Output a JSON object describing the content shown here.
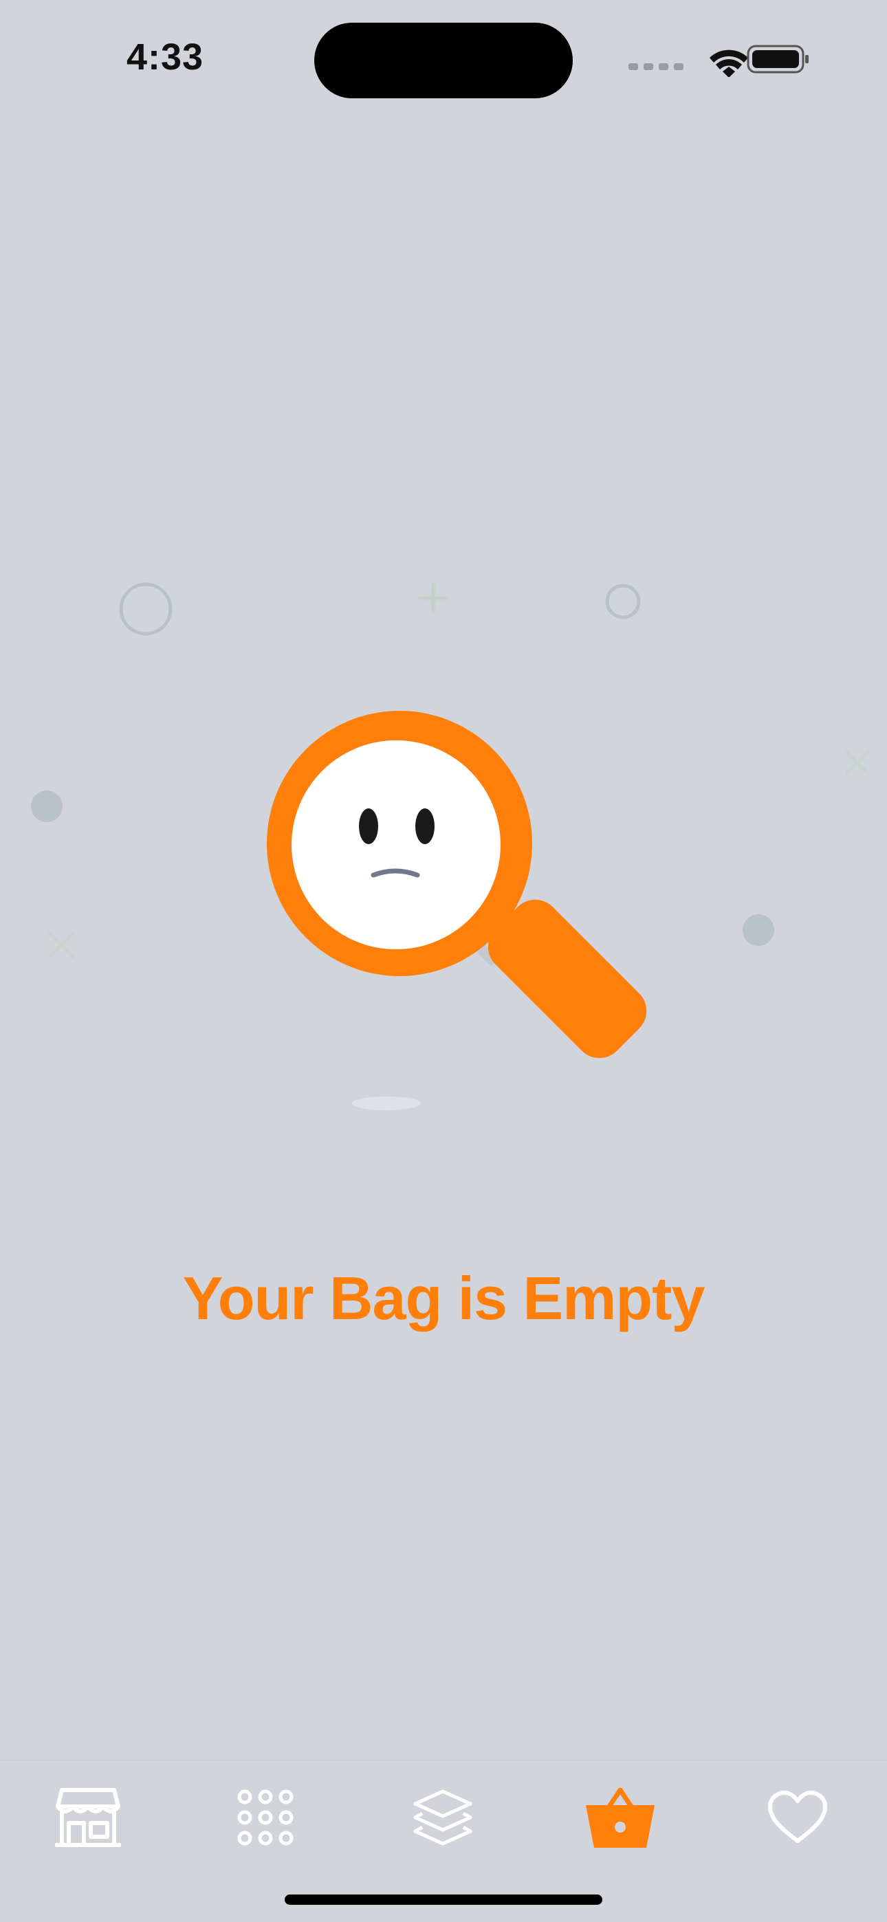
{
  "status_bar": {
    "time": "4:33"
  },
  "empty_state": {
    "title": "Your Bag is Empty",
    "illustration": "magnifying-glass-sad-face"
  },
  "tab_bar": {
    "items": [
      {
        "icon": "store-icon",
        "active": false
      },
      {
        "icon": "grid-dots-icon",
        "active": false
      },
      {
        "icon": "layers-icon",
        "active": false
      },
      {
        "icon": "shopping-basket-icon",
        "active": true
      },
      {
        "icon": "heart-icon",
        "active": false
      }
    ]
  },
  "colors": {
    "accent": "#ff7f0a",
    "background": "#d2d4dc",
    "inactive_icon": "#ffffff"
  }
}
